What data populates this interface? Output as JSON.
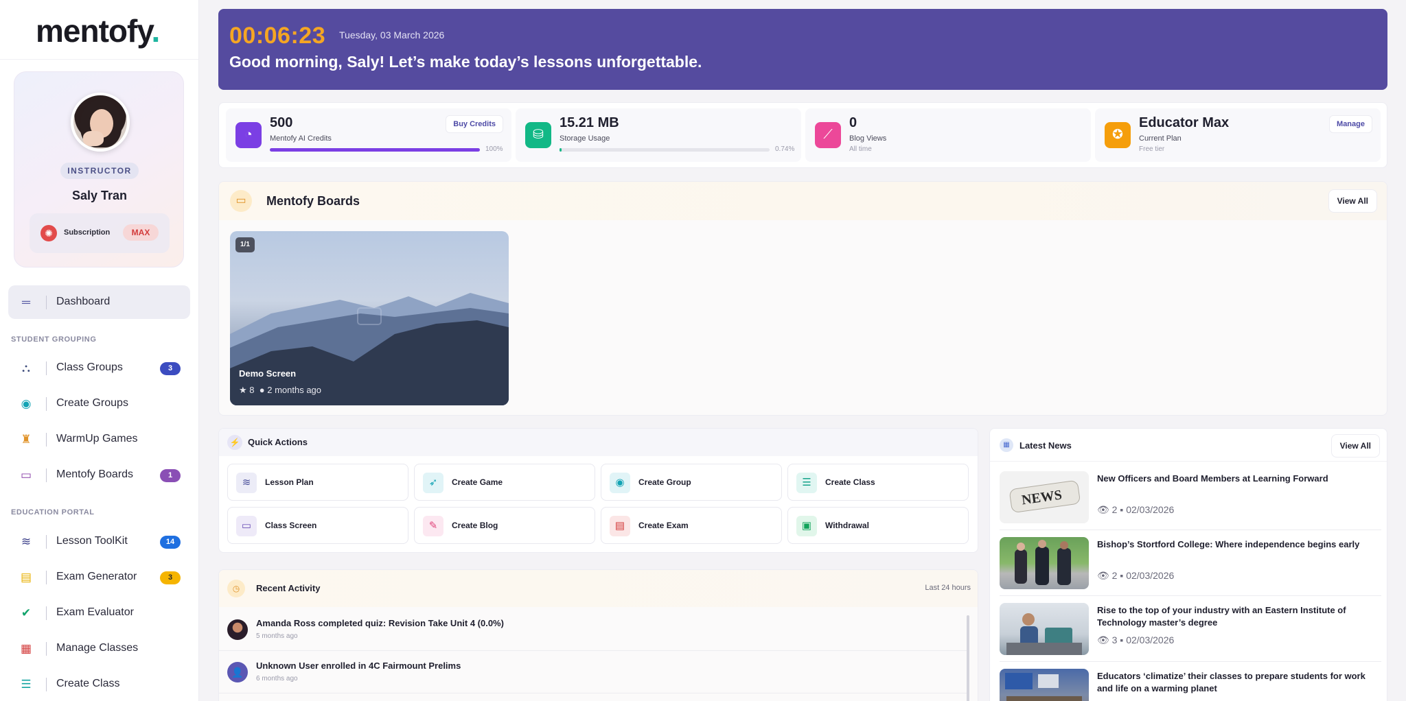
{
  "brand": {
    "name": "mentofy",
    "dot": "."
  },
  "profile": {
    "role": "INSTRUCTOR",
    "name": "Saly Tran",
    "subscription_label": "Subscription",
    "subscription_tier": "MAX"
  },
  "nav": {
    "dashboard": "Dashboard",
    "section_student": "STUDENT GROUPING",
    "section_education": "EDUCATION PORTAL",
    "items": [
      {
        "label": "Class Groups",
        "count": "3"
      },
      {
        "label": "Create Groups"
      },
      {
        "label": "WarmUp Games"
      },
      {
        "label": "Mentofy Boards",
        "count": "1"
      },
      {
        "label": "Lesson ToolKit",
        "count": "14"
      },
      {
        "label": "Exam Generator",
        "count": "3"
      },
      {
        "label": "Exam Evaluator"
      },
      {
        "label": "Manage Classes"
      },
      {
        "label": "Create Class"
      }
    ]
  },
  "hero": {
    "time": "00:06:23",
    "date": "Tuesday, 03 March 2026",
    "greeting": "Good morning, Saly! Let’s make today’s lessons unforgettable."
  },
  "stats": [
    {
      "value": "500",
      "label": "Mentofy AI Credits",
      "button": "Buy Credits",
      "progress": 100,
      "progress_label": "100%",
      "color": "#7b3fe4"
    },
    {
      "value": "15.21 MB",
      "label": "Storage Usage",
      "progress": 0.74,
      "progress_label": "0.74%",
      "color": "#12b886"
    },
    {
      "value": "0",
      "label": "Blog Views",
      "sub": "All time",
      "color": "#ec4899"
    },
    {
      "value": "Educator Max",
      "label": "Current Plan",
      "sub": "Free tier",
      "button": "Manage",
      "color": "#f59e0b"
    }
  ],
  "boards": {
    "title": "Mentofy Boards",
    "view_all": "View All",
    "cards": [
      {
        "badge": "1/1",
        "name": "Demo Screen",
        "stars": "8",
        "age": "2 months ago"
      }
    ]
  },
  "quick_actions": {
    "title": "Quick Actions",
    "items": [
      "Lesson Plan",
      "Create Game",
      "Create Group",
      "Create Class",
      "Class Screen",
      "Create Blog",
      "Create Exam",
      "Withdrawal"
    ]
  },
  "activity": {
    "title": "Recent Activity",
    "range": "Last 24 hours",
    "items": [
      {
        "text": "Amanda Ross completed quiz: Revision Take Unit 4 (0.0%)",
        "time": "5 months ago"
      },
      {
        "text": "Unknown User enrolled in 4C Fairmount Prelims",
        "time": "6 months ago"
      }
    ]
  },
  "news": {
    "title": "Latest News",
    "view_all": "View All",
    "items": [
      {
        "title": "New Officers and Board Members at Learning Forward",
        "views": "2",
        "date": "02/03/2026"
      },
      {
        "title": "Bishop’s Stortford College: Where independence begins early",
        "views": "2",
        "date": "02/03/2026"
      },
      {
        "title": "Rise to the top of your industry with an Eastern Institute of Technology master’s degree",
        "views": "3",
        "date": "02/03/2026"
      },
      {
        "title": "Educators ‘climatize’ their classes to prepare students for work and life on a warming planet"
      }
    ]
  }
}
